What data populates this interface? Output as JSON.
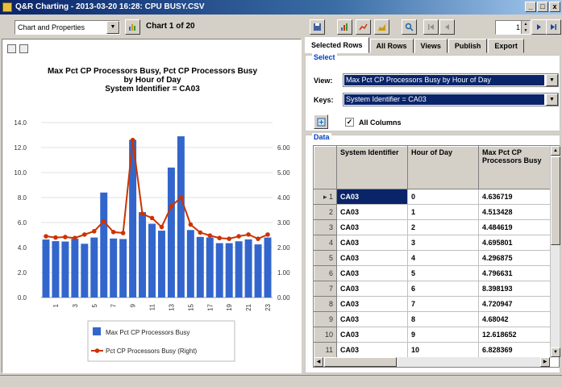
{
  "window": {
    "title": "Q&R Charting - 2013-03-20 16:28: CPU BUSY.CSV",
    "minimize": "_",
    "restore": "□",
    "close": "x"
  },
  "toolbar": {
    "view_select": "Chart and Properties",
    "chart_label": "Chart 1 of 20",
    "page_value": "1"
  },
  "chart": {
    "title_lines": [
      "Max Pct CP Processors Busy,  Pct CP Processors Busy",
      "by Hour of Day",
      "System Identifier = CA03"
    ]
  },
  "chart_data": {
    "type": "bar",
    "title": "Max Pct CP Processors Busy,  Pct CP Processors Busy by Hour of Day System Identifier = CA03",
    "categories": [
      "0",
      "1",
      "2",
      "3",
      "4",
      "5",
      "6",
      "7",
      "8",
      "9",
      "10",
      "11",
      "12",
      "13",
      "14",
      "15",
      "16",
      "17",
      "18",
      "19",
      "20",
      "21",
      "22",
      "23"
    ],
    "x_tick_labels": [
      "1",
      "3",
      "5",
      "7",
      "9",
      "11",
      "13",
      "15",
      "17",
      "19",
      "21",
      "23"
    ],
    "ylim": [
      0,
      14
    ],
    "y_ticks": [
      "0.0",
      "2.0",
      "4.0",
      "6.0",
      "8.0",
      "10.0",
      "12.0",
      "14.0"
    ],
    "y2lim": [
      0,
      7
    ],
    "y2_ticks": [
      "0.00",
      "1.00",
      "2.00",
      "3.00",
      "4.00",
      "5.00",
      "6.00"
    ],
    "series": [
      {
        "name": "Max Pct CP Processors Busy",
        "type": "bar",
        "axis": "left",
        "color": "#3366cc",
        "values": [
          4.64,
          4.51,
          4.48,
          4.7,
          4.3,
          4.8,
          8.4,
          4.72,
          4.68,
          12.62,
          6.83,
          5.9,
          5.35,
          10.4,
          12.9,
          5.4,
          4.85,
          4.8,
          4.35,
          4.35,
          4.5,
          4.65,
          4.25,
          4.8
        ]
      },
      {
        "name": "Pct CP Processors Busy (Right)",
        "type": "line",
        "axis": "right",
        "color": "#cc3300",
        "values": [
          2.45,
          2.4,
          2.42,
          2.38,
          2.52,
          2.65,
          3.05,
          2.62,
          2.58,
          6.3,
          3.35,
          3.18,
          2.82,
          3.65,
          4.0,
          2.92,
          2.6,
          2.48,
          2.38,
          2.35,
          2.45,
          2.52,
          2.35,
          2.52
        ]
      }
    ],
    "legend_position": "bottom"
  },
  "tabs": [
    "Selected Rows",
    "All Rows",
    "Views",
    "Publish",
    "Export"
  ],
  "select_group": {
    "label": "Select",
    "view_label": "View:",
    "view_value": "Max Pct CP Processors Busy by Hour of Day",
    "keys_label": "Keys:",
    "keys_value": "System Identifier = CA03",
    "all_columns_label": "All Columns",
    "check_mark": "✓"
  },
  "data_group": {
    "label": "Data",
    "columns": [
      "System Identifier",
      "Hour of Day",
      "Max Pct CP Processors Busy"
    ],
    "rows": [
      {
        "n": "1",
        "sys": "CA03",
        "hour": "0",
        "max": "4.636719"
      },
      {
        "n": "2",
        "sys": "CA03",
        "hour": "1",
        "max": "4.513428"
      },
      {
        "n": "3",
        "sys": "CA03",
        "hour": "2",
        "max": "4.484619"
      },
      {
        "n": "4",
        "sys": "CA03",
        "hour": "3",
        "max": "4.695801"
      },
      {
        "n": "5",
        "sys": "CA03",
        "hour": "4",
        "max": "4.296875"
      },
      {
        "n": "6",
        "sys": "CA03",
        "hour": "5",
        "max": "4.796631"
      },
      {
        "n": "7",
        "sys": "CA03",
        "hour": "6",
        "max": "8.398193"
      },
      {
        "n": "8",
        "sys": "CA03",
        "hour": "7",
        "max": "4.720947"
      },
      {
        "n": "9",
        "sys": "CA03",
        "hour": "8",
        "max": "4.68042"
      },
      {
        "n": "10",
        "sys": "CA03",
        "hour": "9",
        "max": "12.618652"
      },
      {
        "n": "11",
        "sys": "CA03",
        "hour": "10",
        "max": "6.828369"
      }
    ]
  }
}
